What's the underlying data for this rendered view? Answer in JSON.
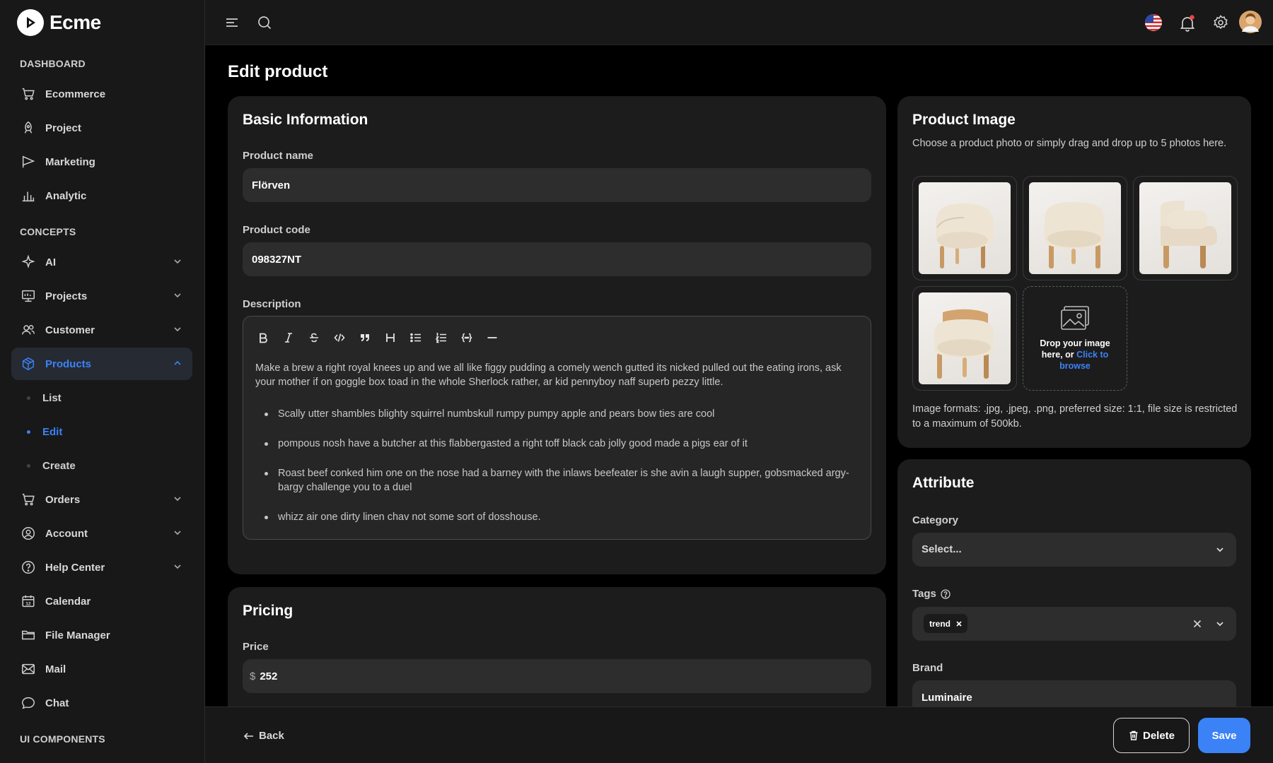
{
  "app": {
    "name": "Ecme"
  },
  "sidebar": {
    "sections": [
      "DASHBOARD",
      "CONCEPTS",
      "UI COMPONENTS"
    ],
    "dashboard_items": [
      {
        "label": "Ecommerce",
        "icon": "cart-icon"
      },
      {
        "label": "Project",
        "icon": "rocket-icon"
      },
      {
        "label": "Marketing",
        "icon": "flag-icon"
      },
      {
        "label": "Analytic",
        "icon": "bar-chart-icon"
      }
    ],
    "concept_items": [
      {
        "label": "AI",
        "icon": "sparkle-icon"
      },
      {
        "label": "Projects",
        "icon": "board-icon"
      },
      {
        "label": "Customer",
        "icon": "users-icon"
      },
      {
        "label": "Products",
        "icon": "box-icon"
      },
      {
        "label": "Orders",
        "icon": "cart-icon"
      },
      {
        "label": "Account",
        "icon": "user-circle-icon"
      },
      {
        "label": "Help Center",
        "icon": "help-icon"
      },
      {
        "label": "Calendar",
        "icon": "calendar-icon"
      },
      {
        "label": "File Manager",
        "icon": "folder-icon"
      },
      {
        "label": "Mail",
        "icon": "mail-icon"
      },
      {
        "label": "Chat",
        "icon": "chat-icon"
      }
    ],
    "products_sub": [
      "List",
      "Edit",
      "Create"
    ],
    "active_item": "Products",
    "active_sub": "Edit"
  },
  "page": {
    "title": "Edit product"
  },
  "basic_info": {
    "title": "Basic Information",
    "product_name_label": "Product name",
    "product_name_value": "Flörven",
    "product_code_label": "Product code",
    "product_code_value": "098327NT",
    "description_label": "Description",
    "description_paragraph": "Make a brew a right royal knees up and we all like figgy pudding a comely wench gutted its nicked pulled out the eating irons, ask your mother if on goggle box toad in the whole Sherlock rather, ar kid pennyboy naff superb pezzy little.",
    "description_bullets": [
      "Scally utter shambles blighty squirrel numbskull rumpy pumpy apple and pears bow ties are cool",
      "pompous nosh have a butcher at this flabbergasted a right toff black cab jolly good made a pigs ear of it",
      "Roast beef conked him one on the nose had a barney with the inlaws beefeater is she avin a laugh supper, gobsmacked argy-bargy challenge you to a duel",
      "whizz air one dirty linen chav not some sort of dosshouse."
    ],
    "toolbar_icons": [
      "bold-icon",
      "italic-icon",
      "strikethrough-icon",
      "code-icon",
      "quote-icon",
      "heading-icon",
      "bullet-list-icon",
      "ordered-list-icon",
      "code-block-icon",
      "horizontal-rule-icon"
    ]
  },
  "pricing": {
    "title": "Pricing",
    "price_label": "Price",
    "currency": "$",
    "price_value": "252"
  },
  "product_image": {
    "title": "Product Image",
    "subtitle": "Choose a product photo or simply drag and drop up to 5 photos here.",
    "drop_text": "Drop your image here, or",
    "drop_link": "Click to browse",
    "formats_note": "Image formats: .jpg, .jpeg, .png, preferred size: 1:1, file size is restricted to a maximum of 500kb."
  },
  "attribute": {
    "title": "Attribute",
    "category_label": "Category",
    "category_placeholder": "Select...",
    "tags_label": "Tags",
    "tags": [
      "trend"
    ],
    "brand_label": "Brand",
    "brand_value": "Luminaire"
  },
  "footer": {
    "back_label": "Back",
    "delete_label": "Delete",
    "save_label": "Save"
  },
  "colors": {
    "accent": "#3b82f6",
    "notification_dot": "#ef4444"
  }
}
